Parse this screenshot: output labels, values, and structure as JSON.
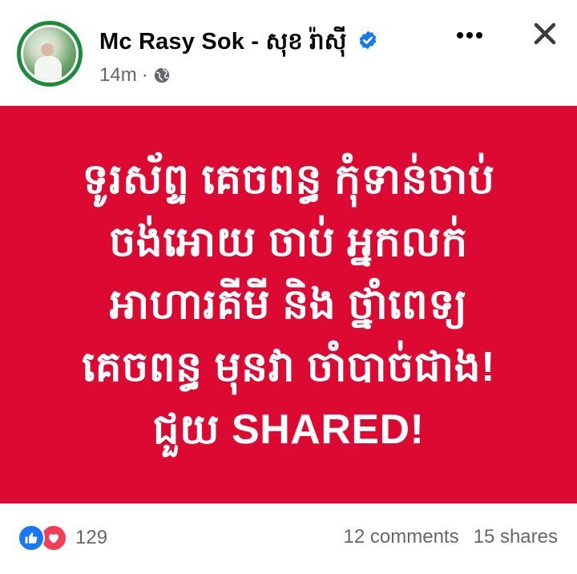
{
  "post": {
    "author": "Mc Rasy Sok - សុខ រ៉ាស៊ី",
    "time": "14m",
    "separator": "·",
    "audience_icon": "globe-icon",
    "verified_icon": "verified-badge-icon",
    "verified_color": "#1877f2"
  },
  "header_actions": {
    "more_icon": "more-horizontal-icon",
    "close_icon": "close-icon"
  },
  "poster": {
    "background_color": "#dc0a32",
    "lines": [
      "ទូរស័ព្ទ គេចពន្ធ កុំទាន់ចាប់",
      "ចង់អោយ ចាប់ អ្នកលក់",
      "អាហារគីមី និង ថ្នាំពេទ្យ",
      "គេចពន្ធ មុនវា ចាំបាច់ជាង!",
      "ជួយ SHARED!"
    ]
  },
  "footer": {
    "reaction_icons": [
      "like-icon",
      "love-icon"
    ],
    "reaction_count": "129",
    "comments": "12 comments",
    "shares": "15 shares"
  }
}
